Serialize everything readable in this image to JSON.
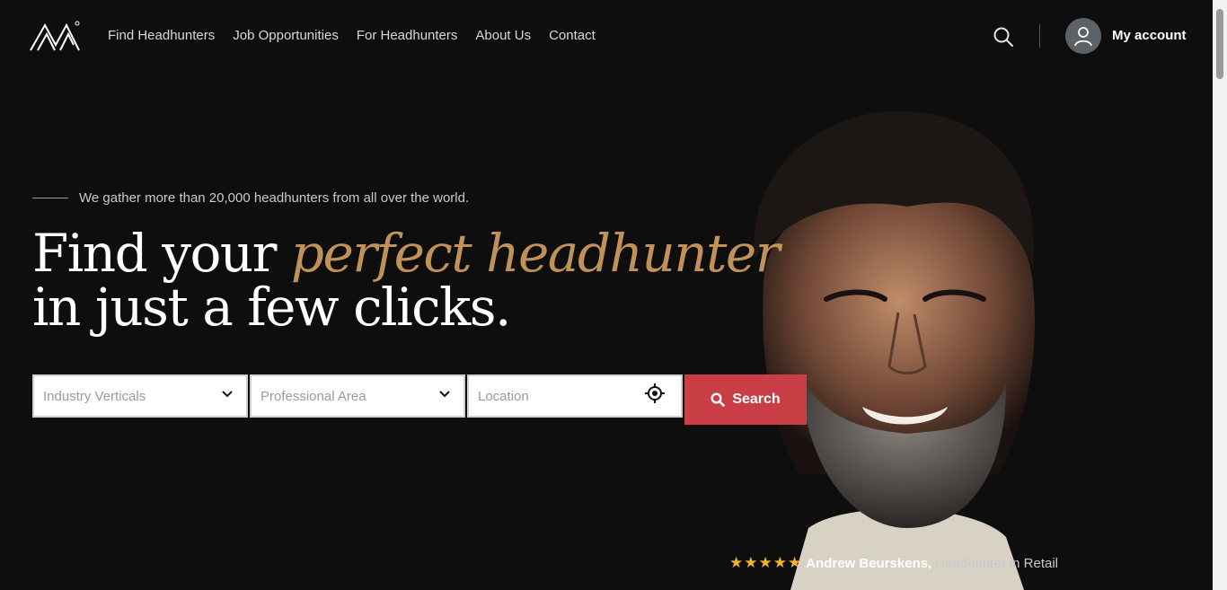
{
  "header": {
    "nav": [
      "Find Headhunters",
      "Job Opportunities",
      "For Headhunters",
      "About Us",
      "Contact"
    ],
    "account_label": "My account"
  },
  "hero": {
    "tagline": "We gather more than 20,000 headhunters from all over the world.",
    "headline_part1": "Find your ",
    "headline_accent": "perfect headhunter",
    "headline_line2": "in just a few clicks.",
    "accent_color": "#c09158"
  },
  "search": {
    "industry_placeholder": "Industry Verticals",
    "area_placeholder": "Professional Area",
    "location_placeholder": "Location",
    "button_label": "Search",
    "button_color": "#c93e45"
  },
  "testimonial": {
    "rating": 5,
    "stars": "★★★★★",
    "name": "Andrew Beurskens,",
    "role": "Headhunter in Retail"
  },
  "icons": [
    "logo-icon",
    "search-icon",
    "user-icon",
    "chevron-down-icon",
    "locate-icon",
    "star-icon"
  ]
}
